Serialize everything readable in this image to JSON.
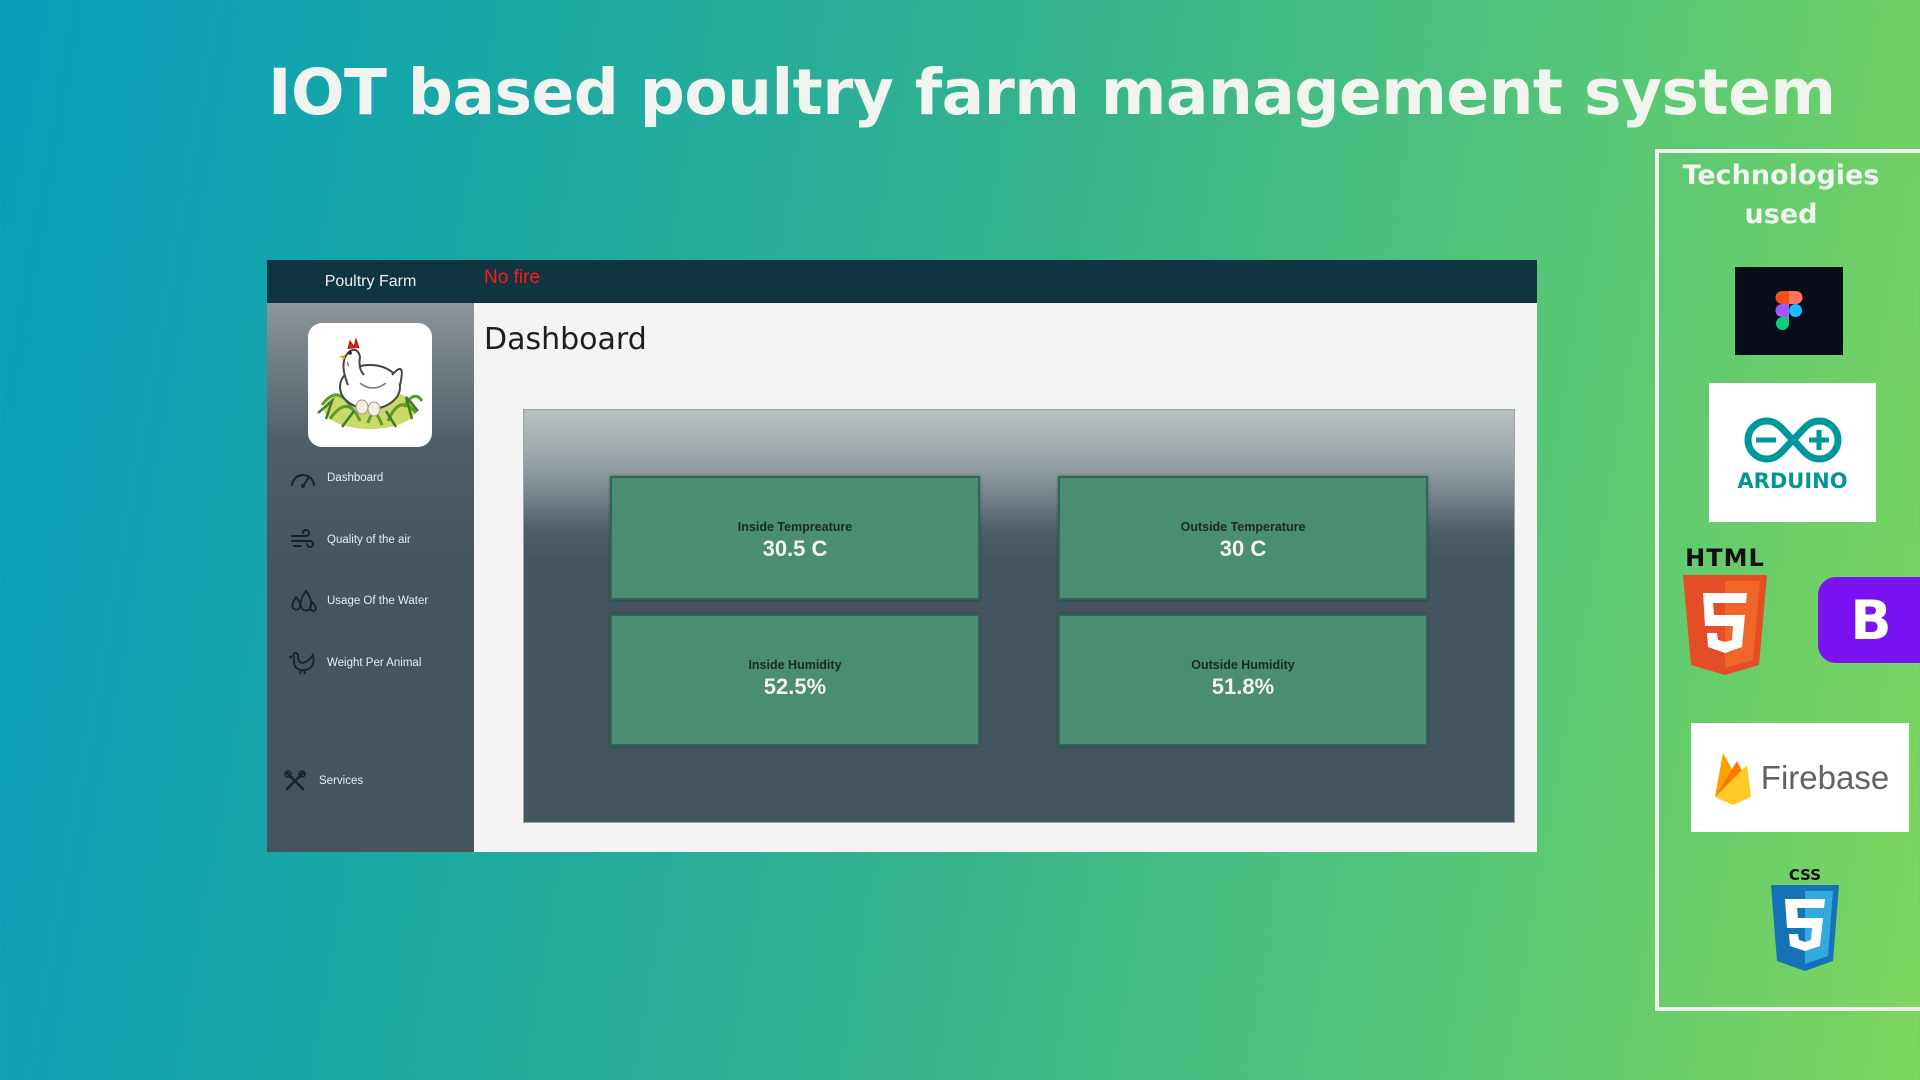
{
  "slide": {
    "title": "IOT based poultry farm management system"
  },
  "app": {
    "brand": "Poultry Farm",
    "fire_status": "No fire",
    "fire_status_color": "#ff1a1a",
    "page_title": "Dashboard",
    "sidebar": {
      "items": [
        {
          "label": "Dashboard",
          "icon": "speedometer-icon"
        },
        {
          "label": "Quality of the air",
          "icon": "wind-icon"
        },
        {
          "label": "Usage Of the Water",
          "icon": "water-drops-icon"
        },
        {
          "label": "Weight Per Animal",
          "icon": "chicken-icon"
        }
      ],
      "footer_item": {
        "label": "Services",
        "icon": "tools-icon"
      }
    },
    "cards": [
      {
        "label": "Inside Tempreature",
        "value": "30.5 C"
      },
      {
        "label": "Outside Temperature",
        "value": "30 C"
      },
      {
        "label": "Inside Humidity",
        "value": "52.5%"
      },
      {
        "label": "Outside Humidity",
        "value": "51.8%"
      }
    ]
  },
  "technologies": {
    "title": "Technologies used",
    "items": [
      {
        "name": "Figma",
        "icon": "figma-logo"
      },
      {
        "name": "ARDUINO",
        "icon": "arduino-logo"
      },
      {
        "name": "HTML",
        "icon": "html5-logo"
      },
      {
        "name": "Bootstrap",
        "icon": "bootstrap-logo",
        "glyph": "B"
      },
      {
        "name": "Firebase",
        "icon": "firebase-logo"
      },
      {
        "name": "CSS",
        "icon": "css3-logo"
      }
    ]
  },
  "colors": {
    "topbar": "#0f3442",
    "card_green": "#4a8d72",
    "bootstrap_purple": "#7a12f2",
    "html_orange": "#e44d26",
    "css_blue": "#1572b6",
    "arduino_teal": "#00979c"
  }
}
